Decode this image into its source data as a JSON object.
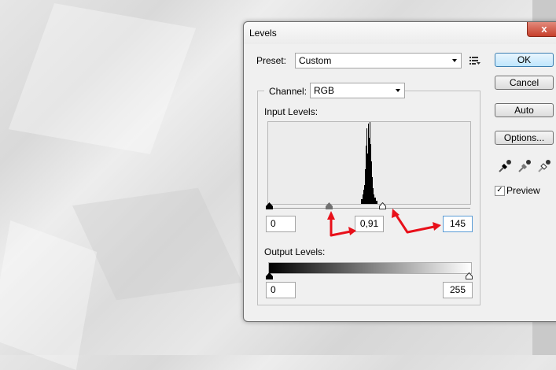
{
  "dialog": {
    "title": "Levels",
    "close_glyph": "x",
    "preset_label": "Preset:",
    "preset_value": "Custom",
    "channel_label": "Channel:",
    "channel_value": "RGB",
    "input_levels_label": "Input Levels:",
    "input_black": "0",
    "input_gamma": "0,91",
    "input_white": "145",
    "output_levels_label": "Output Levels:",
    "output_black": "0",
    "output_white": "255",
    "buttons": {
      "ok": "OK",
      "cancel": "Cancel",
      "auto": "Auto",
      "options": "Options..."
    },
    "preview_label": "Preview",
    "preview_checked": true
  },
  "colors": {
    "annotation_arrow": "#e8101a",
    "ok_border": "#3c7fb1"
  },
  "icons": [
    "preset-options-icon",
    "black-eyedropper-icon",
    "gray-eyedropper-icon",
    "white-eyedropper-icon"
  ]
}
